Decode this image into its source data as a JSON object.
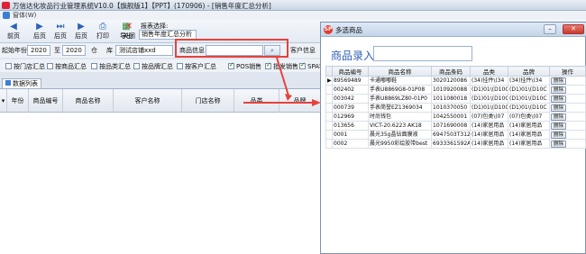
{
  "window": {
    "title": "万信达化妆品行业管理系统V10.0【旗舰版1】【PPT】(170906) - [销售年度汇总分析]"
  },
  "menu": {
    "label": "窗体(W)"
  },
  "toolbar": {
    "buttons": [
      {
        "label": "前页",
        "icon": "arrow-left-icon"
      },
      {
        "label": "后页",
        "icon": "arrow-right-icon"
      },
      {
        "label": "后页",
        "icon": "arrow-right-icon"
      },
      {
        "label": "后页",
        "icon": "arrow-right-icon"
      },
      {
        "label": "打印",
        "icon": "printer-icon"
      },
      {
        "label": "导出",
        "icon": "export-icon"
      },
      {
        "label": "关闭",
        "icon": "close-icon"
      }
    ],
    "report_select_label": "报表选择:",
    "report_select_value": "销售年度汇总分析"
  },
  "filters": {
    "start_year_label": "起始年份",
    "start_year": "2020",
    "to_label": "至",
    "end_year": "2020",
    "warehouse_label": "仓",
    "warehouse_label2": "库",
    "warehouse_value": "测试店铺xxd",
    "product_info_label": "商品信息",
    "customer_info_label": "客户信息"
  },
  "checkboxes": [
    {
      "label": "按门店汇总",
      "checked": false
    },
    {
      "label": "按商品汇总",
      "checked": false
    },
    {
      "label": "按品类汇总",
      "checked": false
    },
    {
      "label": "按品牌汇总",
      "checked": false
    },
    {
      "label": "按客户汇总",
      "checked": false
    },
    {
      "label": "POS销售",
      "checked": true
    },
    {
      "label": "批发销售",
      "checked": true
    },
    {
      "label": "SPA销",
      "checked": true
    }
  ],
  "tab": {
    "label": "数据列表"
  },
  "grid": {
    "columns": [
      "年份",
      "商品编号",
      "商品名称",
      "客户名称",
      "门店名称",
      "品类",
      "品牌"
    ]
  },
  "dialog": {
    "title": "多选商品",
    "product_entry_label": "商品录入",
    "product_entry_value": "",
    "columns": [
      "商品编号",
      "商品名称",
      "商品条码",
      "品类",
      "品牌",
      "操作"
    ],
    "rows": [
      {
        "code": "89569489",
        "name": "卡通嘟嘟鞋",
        "barcode": "3020120086",
        "category": "(34)挂件\\(34",
        "brand": "(34)挂件\\(34",
        "action": "删除"
      },
      {
        "code": "002402",
        "name": "手表U8869G8-01P08",
        "barcode": "1010920088",
        "category": "(D1)01\\(D10C",
        "brand": "(D1)01\\(D10C",
        "action": "删除"
      },
      {
        "code": "003042",
        "name": "手表U8869LZ80-01P0",
        "barcode": "1011080018",
        "category": "(D1)01\\(D10C",
        "brand": "(D1)01\\(D10C",
        "action": "删除"
      },
      {
        "code": "000739",
        "name": "手表简誉EZ1369034",
        "barcode": "1010370050",
        "category": "(D1)01\\(D10C",
        "brand": "(D1)01\\(D10C",
        "action": "删除"
      },
      {
        "code": "012969",
        "name": "时尚钱包",
        "barcode": "1042550001",
        "category": "(07)包类\\(07",
        "brand": "(07)包类\\(07",
        "action": "删除"
      },
      {
        "code": "013656",
        "name": "VICT-20.6223 AK18",
        "barcode": "1071690008",
        "category": "(14)家居用品",
        "brand": "(14)家居用品",
        "action": "删除"
      },
      {
        "code": "0001",
        "name": "晨光35g晶钻面膜液",
        "barcode": "6947503T312",
        "category": "(14)家居用品",
        "brand": "(14)家居用品",
        "action": "删除"
      },
      {
        "code": "0002",
        "name": "晨光9950彩绘胶带best",
        "barcode": "6933361592A",
        "category": "(14)家居用品",
        "brand": "(14)家居用品",
        "action": "删除"
      }
    ]
  }
}
